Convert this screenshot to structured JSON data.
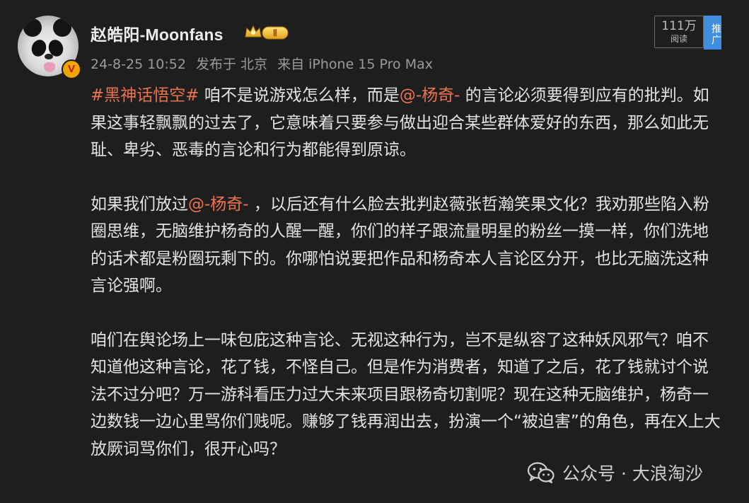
{
  "post": {
    "author": {
      "name": "赵皓阳-Moonfans",
      "verified_badge": "V",
      "member_badge_level": "Ⅱ"
    },
    "meta": {
      "time": "24-8-25 10:52",
      "location": "发布于 北京",
      "source": "来自 iPhone 15 Pro Max"
    },
    "reads": {
      "count": "111万",
      "label": "阅读"
    },
    "promote_label": "推广",
    "paragraphs": [
      {
        "segments": [
          {
            "text": "#黑神话悟空#",
            "highlight": true
          },
          {
            "text": " 咱不是说游戏怎么样，而是",
            "highlight": false
          },
          {
            "text": "@-杨奇-",
            "highlight": true
          },
          {
            "text": " 的言论必须要得到应有的批判。如果这事轻飘飘的过去了，它意味着只要参与做出迎合某些群体爱好的东西，那么如此无耻、卑劣、恶毒的言论和行为都能得到原谅。",
            "highlight": false
          }
        ]
      },
      {
        "segments": [
          {
            "text": "如果我们放过",
            "highlight": false
          },
          {
            "text": "@-杨奇-",
            "highlight": true
          },
          {
            "text": " ，以后还有什么脸去批判赵薇张哲瀚笑果文化？我劝那些陷入粉圈思维，无脑维护杨奇的人醒一醒，你们的样子跟流量明星的粉丝一摸一样，你们洗地的话术都是粉圈玩剩下的。你哪怕说要把作品和杨奇本人言论区分开，也比无脑洗这种言论强啊。",
            "highlight": false
          }
        ]
      },
      {
        "segments": [
          {
            "text": "咱们在舆论场上一味包庇这种言论、无视这种行为，岂不是纵容了这种妖风邪气？咱不知道他这种言论，花了钱，不怪自己。但是作为消费者，知道了之后，花了钱就讨个说法不过分吧？万一游科看压力过大未来项目跟杨奇切割呢？现在这种无脑维护，杨奇一边数钱一边心里骂你们贱呢。赚够了钱再润出去，扮演一个“被迫害”的角色，再在X上大放厥词骂你们，很开心吗？",
            "highlight": false
          }
        ]
      }
    ]
  },
  "watermark": {
    "text": "公众号 · 大浪淘沙",
    "icon": "wechat-icon"
  },
  "colors": {
    "background": "#1e1e1e",
    "text": "#e3e3e3",
    "highlight": "#eb7350",
    "meta": "#9a9a9a",
    "promote": "#3f8fe0",
    "badge_gold": "#f0a500"
  }
}
